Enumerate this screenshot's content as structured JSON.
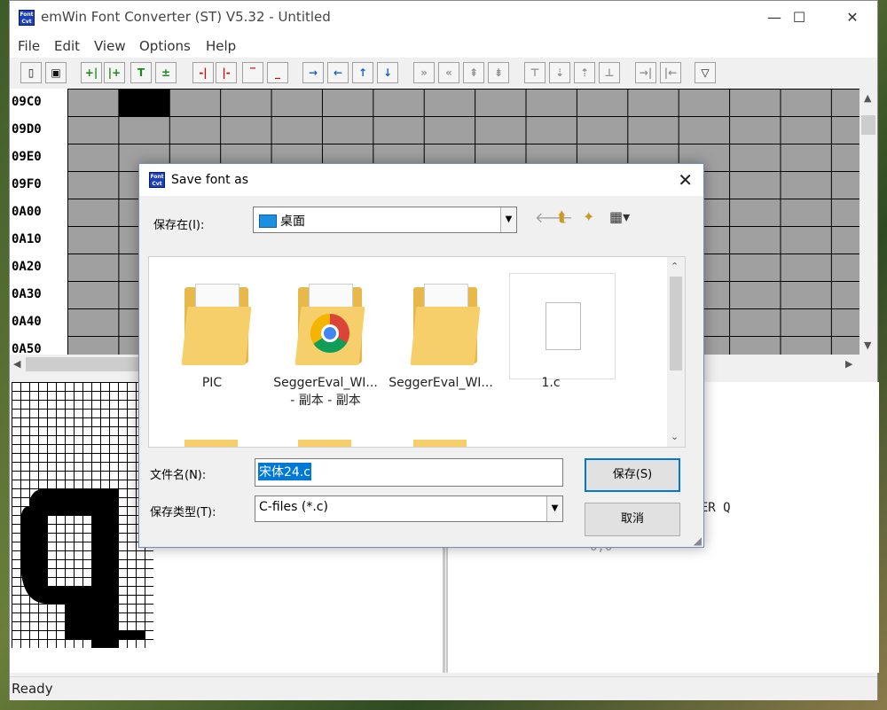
{
  "main_window": {
    "title": "emWin Font Converter (ST) V5.32 - Untitled",
    "icon_text_top": "Font",
    "icon_text_bottom": "Cvt",
    "menu": [
      "File",
      "Edit",
      "View",
      "Options",
      "Help"
    ],
    "toolbar_icons": [
      "new-file-icon",
      "save-icon",
      "insert-col-left-icon",
      "insert-col-right-icon",
      "insert-row-top-icon",
      "insert-row-bottom-icon",
      "delete-col-left-icon",
      "delete-col-right-icon",
      "delete-row-top-icon",
      "delete-row-bottom-icon",
      "arrow-right-icon",
      "arrow-left-icon",
      "arrow-up-icon",
      "arrow-down-icon",
      "shift-right-icon",
      "shift-left-icon",
      "shift-up-icon",
      "shift-down-icon",
      "move-top-icon",
      "move-down-icon",
      "move-up-icon",
      "move-bottom-icon",
      "align-right-icon",
      "align-left-icon",
      "filter-icon"
    ],
    "row_labels": [
      "09C0",
      "09D0",
      "09E0",
      "09F0",
      "0A00",
      "0A10",
      "0A20",
      "0A30",
      "0A40",
      "0A50"
    ],
    "status": "Ready",
    "code_fragments": [
      "TTER Q",
      "0,0"
    ]
  },
  "dialog": {
    "title": "Save font as",
    "save_in_label": "保存在(I):",
    "save_in_value": "桌面",
    "files": [
      {
        "name": "PIC",
        "name2": "",
        "type": "folder"
      },
      {
        "name": "SeggerEval_WI...",
        "name2": "- 副本 - 副本",
        "type": "folder-chrome"
      },
      {
        "name": "SeggerEval_WI...",
        "name2": "",
        "type": "folder-docs"
      },
      {
        "name": "1.c",
        "name2": "",
        "type": "file"
      }
    ],
    "filename_label": "文件名(N):",
    "filename_value": "宋体24.c",
    "filetype_label": "保存类型(T):",
    "filetype_value": "C-files (*.c)",
    "save_button": "保存(S)",
    "cancel_button": "取消"
  }
}
